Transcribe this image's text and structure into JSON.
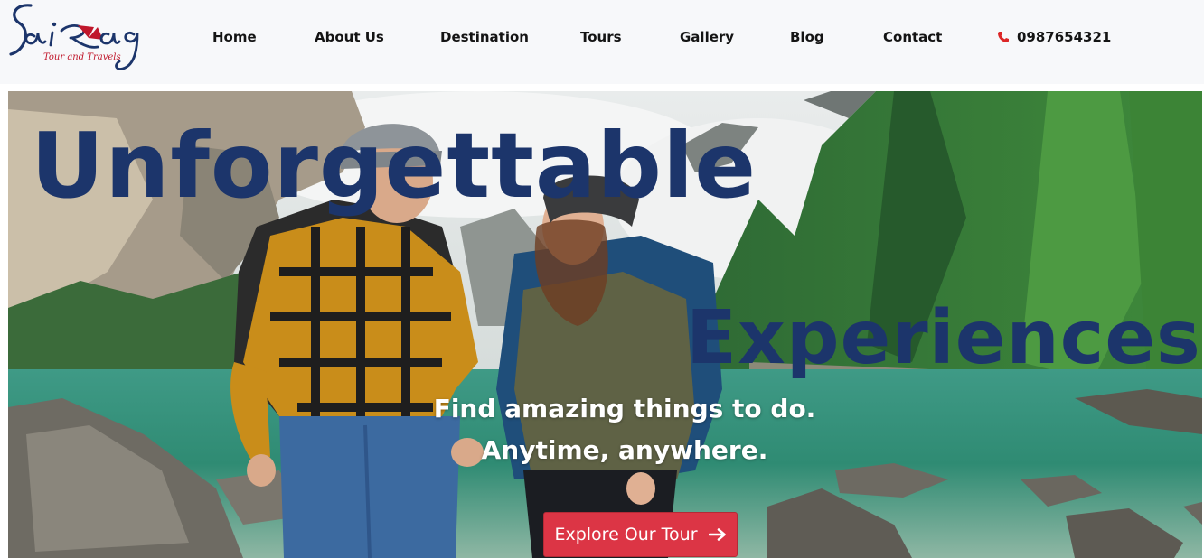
{
  "brand": {
    "name": "Sai Rag",
    "sub": "Tour and Travels",
    "color_primary": "#1c356b",
    "color_accent": "#c0172b"
  },
  "nav": {
    "items": [
      {
        "label": "Home"
      },
      {
        "label": "About Us"
      },
      {
        "label": "Destination"
      },
      {
        "label": "Tours"
      },
      {
        "label": "Gallery"
      },
      {
        "label": "Blog"
      },
      {
        "label": "Contact"
      }
    ],
    "phone": {
      "icon": "phone-icon",
      "number": "0987654321"
    }
  },
  "hero": {
    "headline_1": "Unforgettable",
    "headline_2": "Experiences",
    "tagline_1": "Find amazing things to do.",
    "tagline_2": "Anytime, anywhere.",
    "cta_label": "Explore Our Tour",
    "cta_icon": "arrow-right-icon",
    "cta_color": "#dc3545",
    "headline_color": "#1c356b"
  }
}
